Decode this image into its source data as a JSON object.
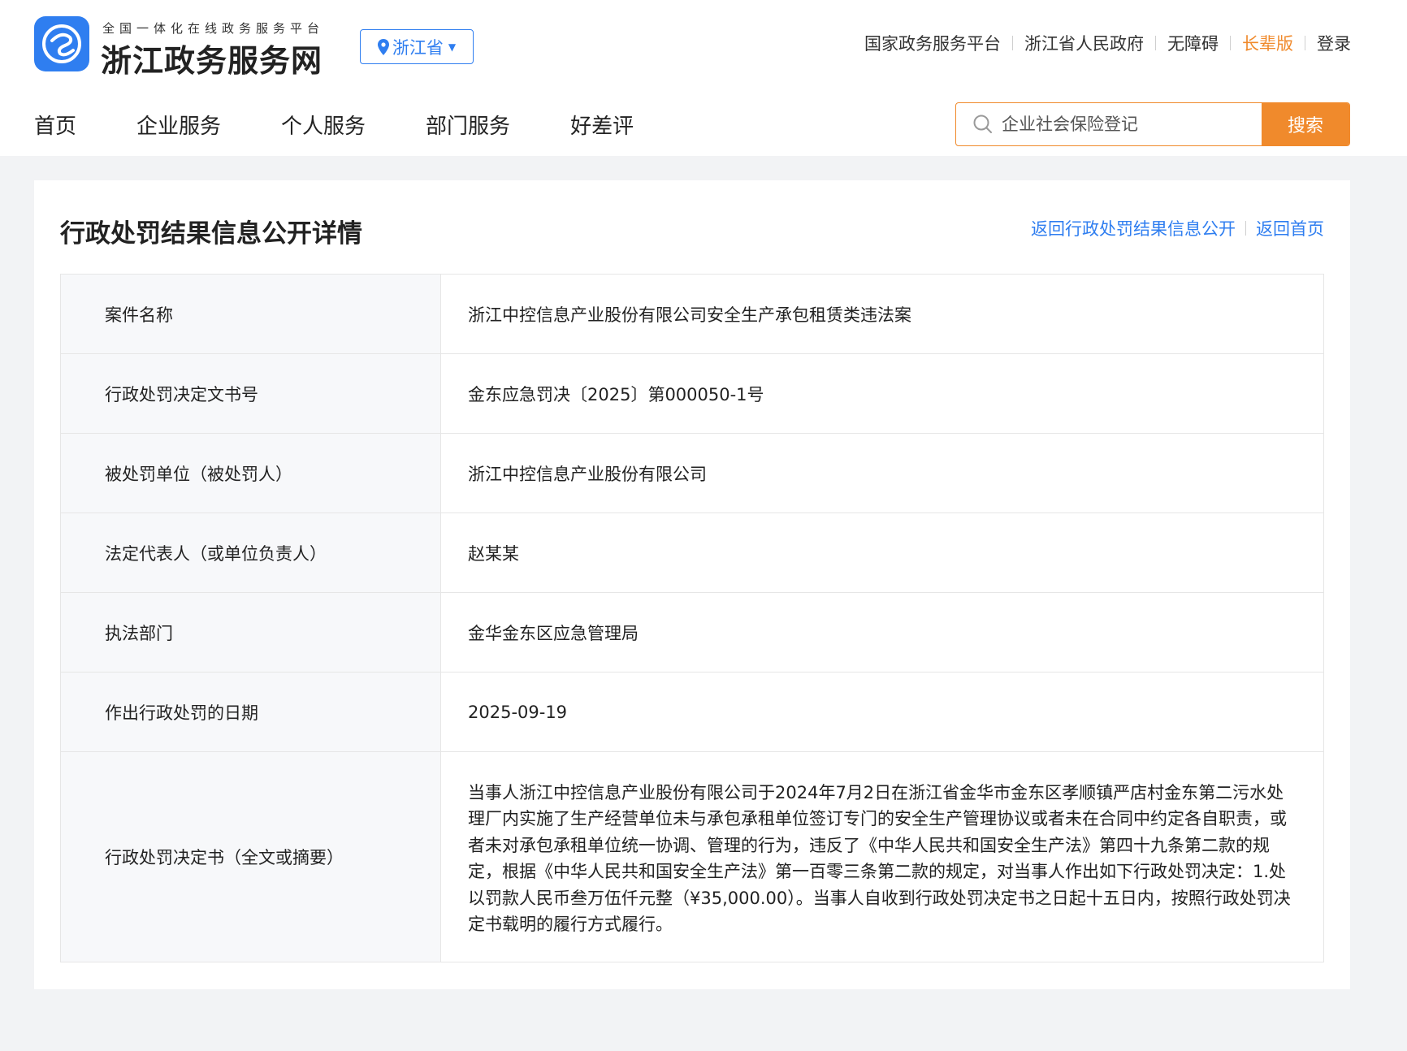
{
  "header": {
    "logo_subtitle": "全国一体化在线政务服务平台",
    "logo_title": "浙江政务服务网",
    "region": "浙江省",
    "top_links": {
      "national": "国家政务服务平台",
      "provincial_gov": "浙江省人民政府",
      "accessibility": "无障碍",
      "elder": "长辈版",
      "login": "登录"
    },
    "nav": {
      "home": "首页",
      "enterprise": "企业服务",
      "personal": "个人服务",
      "department": "部门服务",
      "review": "好差评"
    },
    "search": {
      "placeholder": "企业社会保险登记",
      "button": "搜索"
    }
  },
  "card": {
    "title": "行政处罚结果信息公开详情",
    "back_list": "返回行政处罚结果信息公开",
    "back_home": "返回首页",
    "rows": [
      {
        "label": "案件名称",
        "value": "浙江中控信息产业股份有限公司安全生产承包租赁类违法案"
      },
      {
        "label": "行政处罚决定文书号",
        "value": "金东应急罚决〔2025〕第000050-1号"
      },
      {
        "label": "被处罚单位（被处罚人）",
        "value": "浙江中控信息产业股份有限公司"
      },
      {
        "label": "法定代表人（或单位负责人）",
        "value": "赵某某"
      },
      {
        "label": "执法部门",
        "value": "金华金东区应急管理局"
      },
      {
        "label": "作出行政处罚的日期",
        "value": "2025-09-19"
      },
      {
        "label": "行政处罚决定书（全文或摘要）",
        "value": "当事人浙江中控信息产业股份有限公司于2024年7月2日在浙江省金华市金东区孝顺镇严店村金东第二污水处理厂内实施了生产经营单位未与承包承租单位签订专门的安全生产管理协议或者未在合同中约定各自职责，或者未对承包承租单位统一协调、管理的行为，违反了《中华人民共和国安全生产法》第四十九条第二款的规定，根据《中华人民共和国安全生产法》第一百零三条第二款的规定，对当事人作出如下行政处罚决定：1.处以罚款人民币叁万伍仟元整（¥35,000.00）。当事人自收到行政处罚决定书之日起十五日内，按照行政处罚决定书载明的履行方式履行。"
      }
    ]
  },
  "colors": {
    "brand_blue": "#2f7ef0",
    "accent_orange": "#f08a2c"
  }
}
